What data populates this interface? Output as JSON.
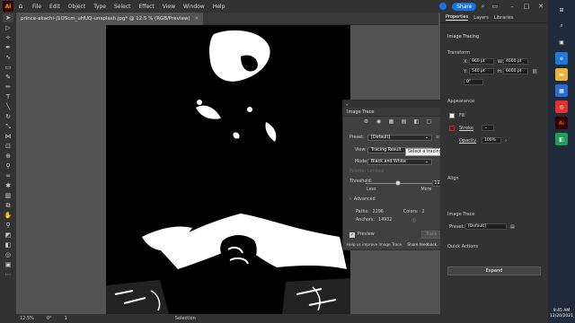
{
  "app": {
    "logo": "Ai",
    "menu": [
      "File",
      "Edit",
      "Object",
      "Type",
      "Select",
      "Effect",
      "View",
      "Window",
      "Help"
    ],
    "share_label": "Share"
  },
  "document": {
    "tab_label": "prince-akachi-J1OScm_uHUQ-unsplash.jpg* @ 12.5 % (RGB/Preview)"
  },
  "status": {
    "zoom": "12.5%",
    "rotation": "0°",
    "artboard": "1",
    "tool": "Selection"
  },
  "image_trace": {
    "panel_title": "Image Trace",
    "preset_label": "Preset:",
    "preset_value": "[Default]",
    "view_label": "View:",
    "view_value": "Tracing Result",
    "mode_label": "Mode:",
    "mode_value": "Black and White",
    "palette_label": "Palette:",
    "palette_value": "Limited",
    "threshold_label": "Threshold:",
    "threshold_value": "128",
    "threshold_fraction": 0.5,
    "less_label": "Less",
    "more_label": "More",
    "advanced_label": "Advanced",
    "paths_label": "Paths:",
    "paths_value": "2296",
    "colors_label": "Colors:",
    "colors_value": "2",
    "anchors_label": "Anchors:",
    "anchors_value": "14932",
    "preview_label": "Preview",
    "trace_button": "Trace",
    "help_text": "Help us improve Image Trace.",
    "feedback_link": "Share feedback.",
    "tooltip": "Select a tracing preset"
  },
  "properties": {
    "tabs": [
      "Properties",
      "Layers",
      "Libraries"
    ],
    "section_title": "Image Tracing",
    "transform_label": "Transform",
    "x_label": "X:",
    "x_value": "960 pt",
    "y_label": "Y:",
    "y_value": "540 pt",
    "w_label": "W:",
    "w_value": "4000 pt",
    "h_label": "H:",
    "h_value": "6000 pt",
    "angle_value": "0°",
    "appearance_label": "Appearance",
    "fill_label": "Fill",
    "stroke_label": "Stroke",
    "opacity_label": "Opacity",
    "opacity_value": "100%",
    "align_label": "Align",
    "image_trace_label": "Image Trace",
    "preset_label": "Preset:",
    "preset_value": "[Default]",
    "quick_actions_label": "Quick Actions",
    "expand_label": "Expand"
  },
  "taskbar": {
    "time": "9:45 AM",
    "date": "12/20/2021"
  }
}
